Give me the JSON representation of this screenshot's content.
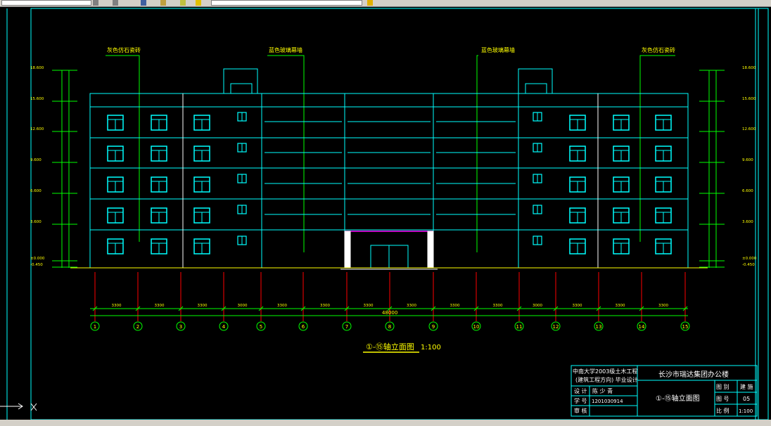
{
  "labels": {
    "material_left": "灰色仿石瓷砖",
    "material_center_left": "蓝色玻璃幕墙",
    "material_center_right": "蓝色玻璃幕墙",
    "material_right": "灰色仿石瓷砖",
    "drawing_title": "①-⑮轴立面图",
    "drawing_scale": "1:100",
    "overall_dimension": "48000"
  },
  "levels": [
    "18.600",
    "15.600",
    "12.600",
    "9.600",
    "6.600",
    "3.600",
    "±0.000",
    "-0.450"
  ],
  "axes": [
    "1",
    "2",
    "3",
    "4",
    "5",
    "6",
    "7",
    "8",
    "9",
    "10",
    "11",
    "12",
    "13",
    "14",
    "15"
  ],
  "bay_dimensions": [
    "3300",
    "3300",
    "3300",
    "3000",
    "3300",
    "3300",
    "3300",
    "3300",
    "3300",
    "3300",
    "3000",
    "3300",
    "3300",
    "3300"
  ],
  "title_block": {
    "school_line1": "中南大学2003级土木工程",
    "school_line2": "(建筑工程方向) 毕业设计",
    "project_name": "长沙市瑞达集团办公楼",
    "drawing_name": "①-⑮轴立面图",
    "row_design_label": "设 计",
    "designer": "陈 少 青",
    "row_id_label": "学 号",
    "student_id": "1201030914",
    "row_review_label": "审 核",
    "reviewer": "",
    "cell_category_label": "图 别",
    "cell_category_value": "建 施",
    "cell_number_label": "图 号",
    "cell_number_value": "05",
    "cell_scale_label": "比 例",
    "cell_scale_value": "1:100"
  },
  "colors": {
    "background": "#000000",
    "frame": "#00ffff",
    "window": "#00ffff",
    "leader": "#00ff00",
    "axis_line": "#ff0000",
    "annotation": "#ffff00",
    "building": "#00ffff",
    "entrance_top": "#ff00ff"
  }
}
